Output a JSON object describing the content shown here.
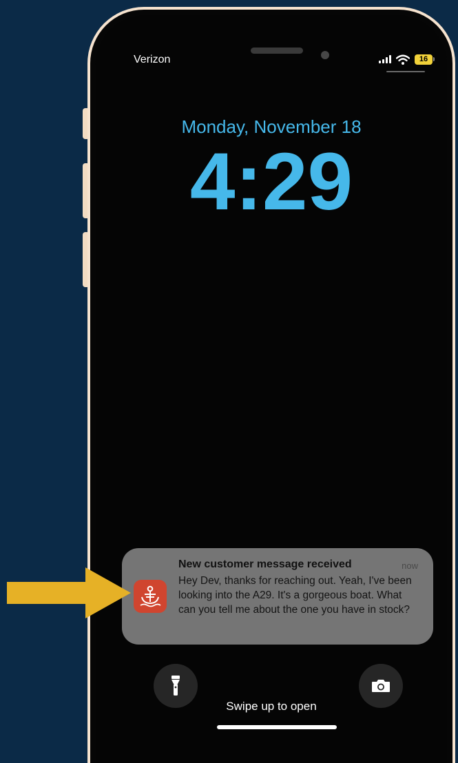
{
  "status_bar": {
    "carrier": "Verizon",
    "battery_level": "16",
    "signal_icon": "cellular-signal-icon",
    "wifi_icon": "wifi-icon",
    "battery_icon": "battery-icon"
  },
  "lock_screen": {
    "date": "Monday, November 18",
    "time": "4:29",
    "accent_color": "#46b8ea"
  },
  "notification": {
    "title": "New customer message received",
    "timestamp": "now",
    "body": "Hey Dev, thanks for reaching out. Yeah, I've been looking into the A29. It's a gorgeous boat. What can you tell me about the one you have in stock?",
    "app_icon": "anchor-app-icon",
    "app_color": "#d0452f"
  },
  "quick_actions": {
    "flashlight_icon": "flashlight-icon",
    "camera_icon": "camera-icon"
  },
  "footer": {
    "swipe_text": "Swipe up to open"
  },
  "annotation": {
    "arrow_color": "#e6b126",
    "arrow_icon": "arrow-right-icon"
  }
}
